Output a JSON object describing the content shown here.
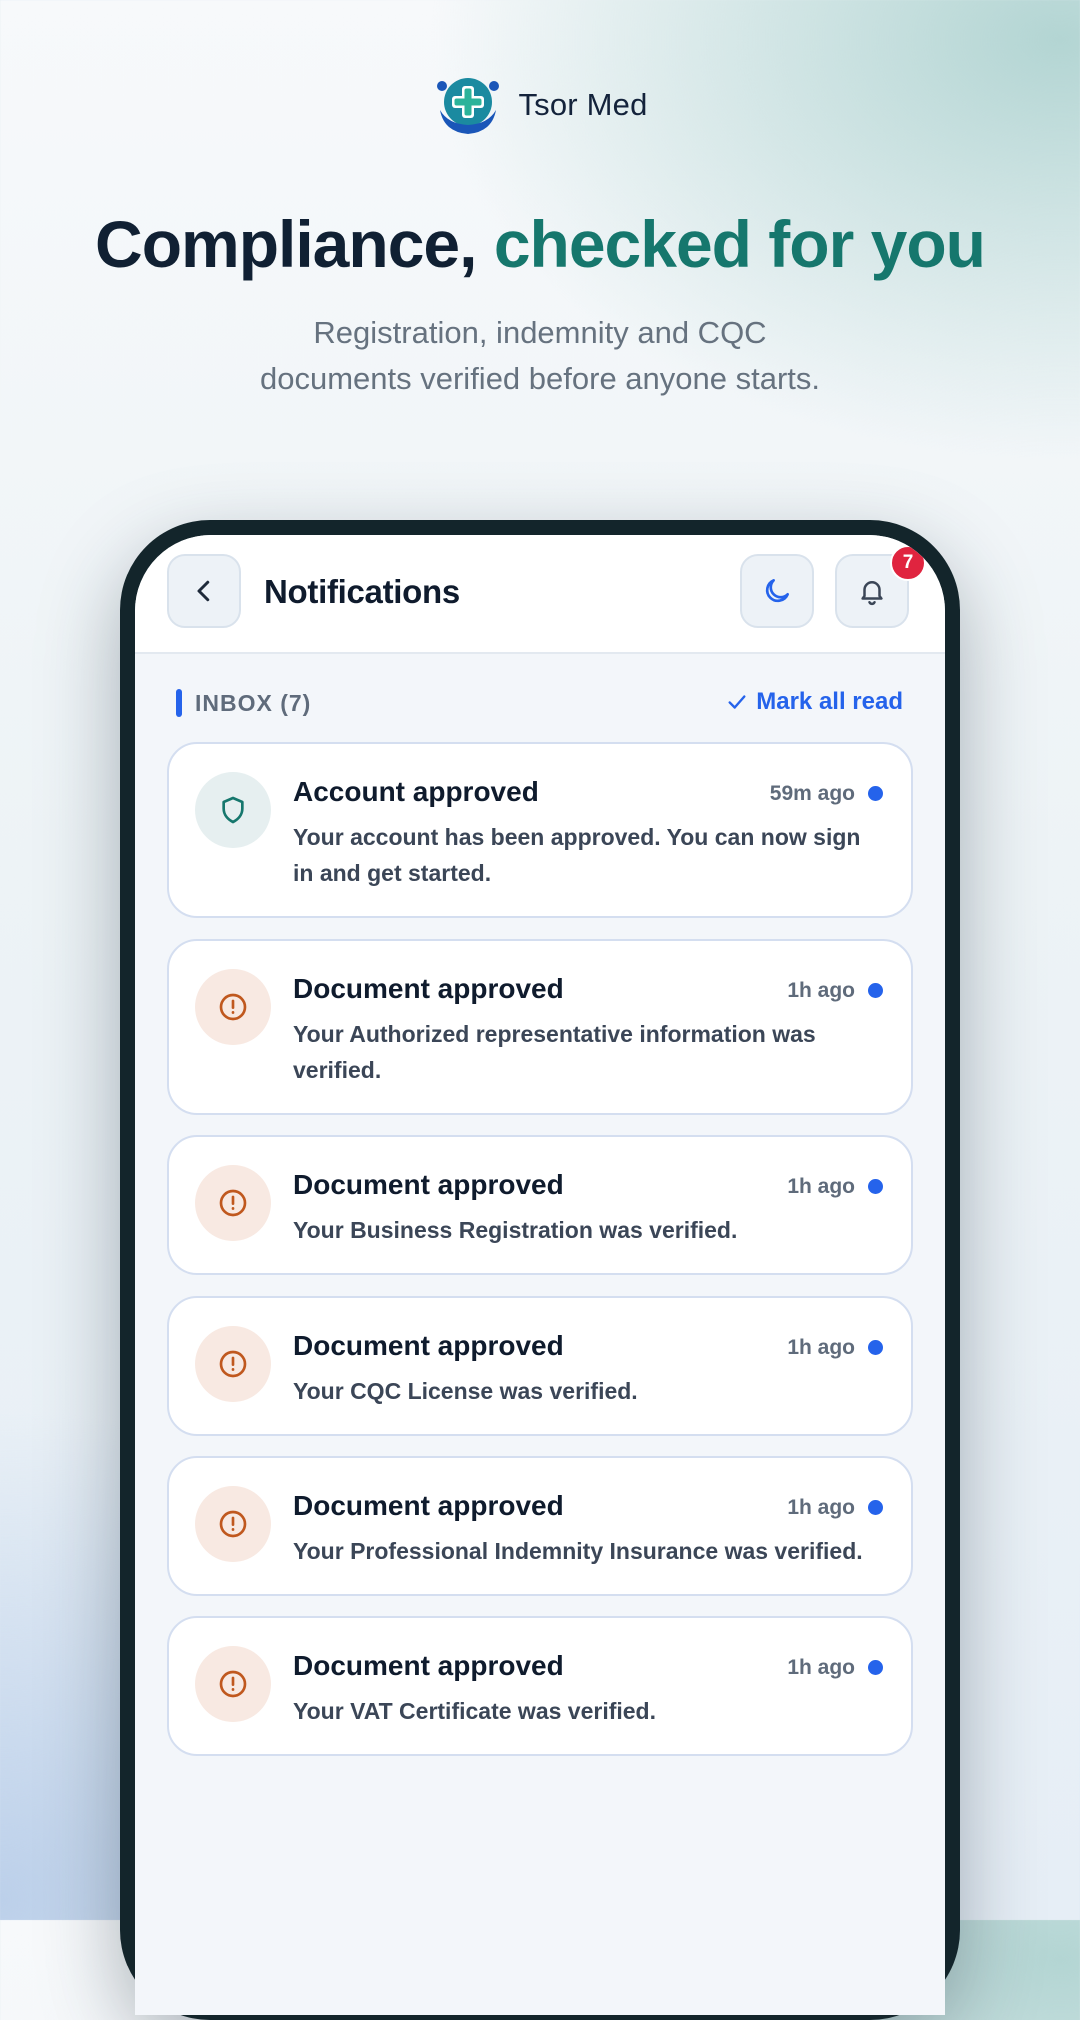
{
  "brand": {
    "name": "Tsor Med"
  },
  "hero": {
    "title_main": "Compliance,",
    "title_accent": "checked for you",
    "subtitle_line1": "Registration, indemnity and CQC",
    "subtitle_line2": "documents verified before anyone starts."
  },
  "appbar": {
    "title": "Notifications",
    "back_icon": "chevron-left-icon",
    "theme_icon": "moon-icon",
    "bell_icon": "bell-icon",
    "badge_count": "7"
  },
  "inbox": {
    "label": "INBOX (7)",
    "mark_all_read": "Mark all read"
  },
  "notifications": [
    {
      "icon": "shield-icon",
      "title": "Account approved",
      "time": "59m ago",
      "unread": true,
      "body": "Your account has been approved. You can now sign in and get started."
    },
    {
      "icon": "alert-circle-icon",
      "title": "Document approved",
      "time": "1h ago",
      "unread": true,
      "body": "Your Authorized representative information was verified."
    },
    {
      "icon": "alert-circle-icon",
      "title": "Document approved",
      "time": "1h ago",
      "unread": true,
      "body": "Your Business Registration was verified."
    },
    {
      "icon": "alert-circle-icon",
      "title": "Document approved",
      "time": "1h ago",
      "unread": true,
      "body": "Your CQC License was verified."
    },
    {
      "icon": "alert-circle-icon",
      "title": "Document approved",
      "time": "1h ago",
      "unread": true,
      "body": "Your Professional Indemnity Insurance was verified."
    },
    {
      "icon": "alert-circle-icon",
      "title": "Document approved",
      "time": "1h ago",
      "unread": true,
      "body": "Your VAT Certificate was verified."
    }
  ],
  "colors": {
    "accent_teal": "#16776d",
    "primary_blue": "#2563eb",
    "badge_red": "#e0243f",
    "alert_orange": "#c0581e"
  }
}
